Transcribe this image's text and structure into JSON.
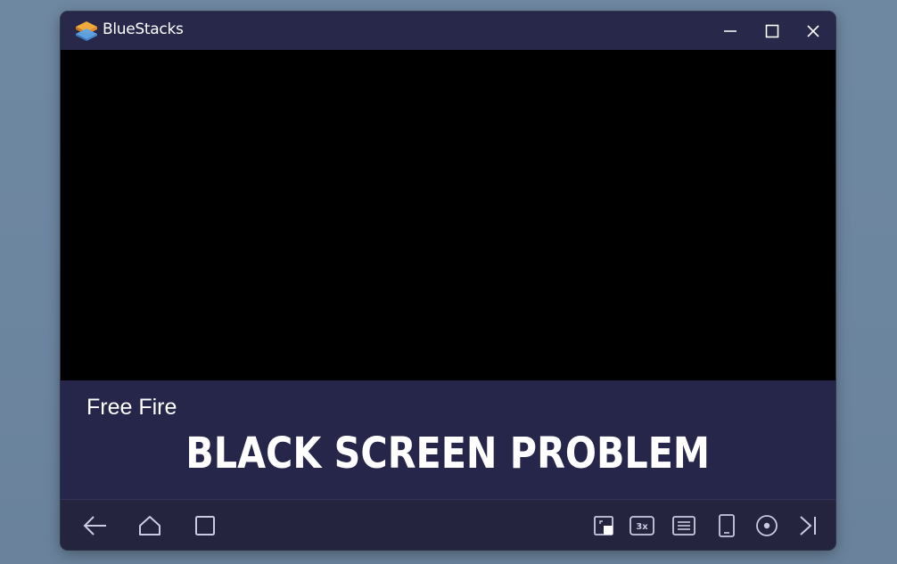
{
  "window": {
    "app_title": "BlueStacks",
    "controls": {
      "minimize_icon": "minimize-icon",
      "maximize_icon": "maximize-icon",
      "close_icon": "close-icon"
    }
  },
  "caption": {
    "game_name": "Free Fire",
    "headline": "BLACK SCREEN PROBLEM"
  },
  "navbar": {
    "left_icons": [
      "back-icon",
      "home-icon",
      "recent-apps-icon"
    ],
    "right_icons": [
      "screenshot-icon",
      "speed-3x-icon",
      "menu-list-icon",
      "tablet-icon",
      "record-icon",
      "skip-end-icon"
    ],
    "speed_label": "3x"
  },
  "colors": {
    "window_bg": "#24243e",
    "titlebar_bg": "#27284a",
    "screen_bg": "#000000",
    "text": "#ffffff",
    "icon": "#c9cbe0"
  }
}
